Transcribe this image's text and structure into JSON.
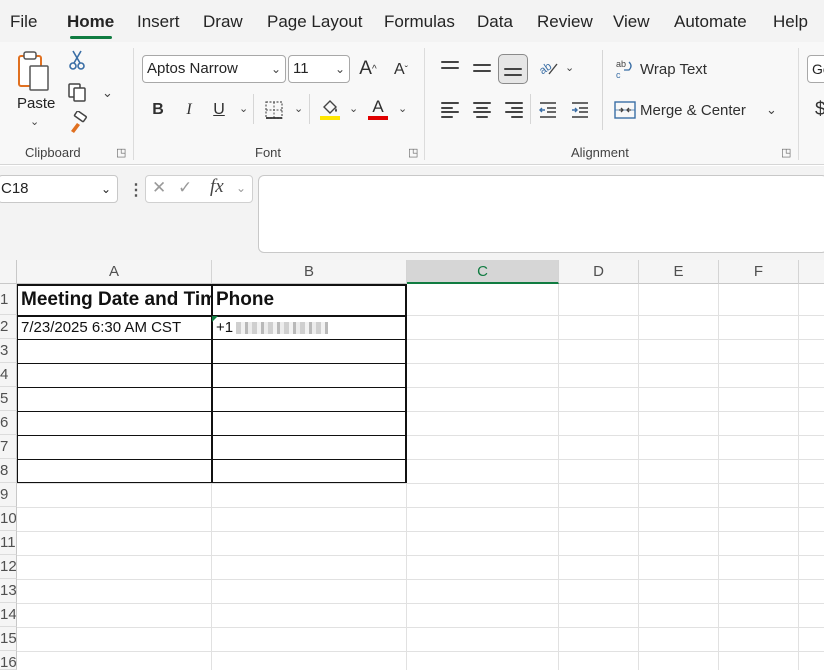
{
  "tabs": [
    "File",
    "Home",
    "Insert",
    "Draw",
    "Page Layout",
    "Formulas",
    "Data",
    "Review",
    "View",
    "Automate",
    "Help"
  ],
  "active_tab": "Home",
  "ribbon": {
    "clipboard": {
      "paste_label": "Paste",
      "group_label": "Clipboard"
    },
    "font": {
      "font_name": "Aptos Narrow",
      "font_size": "11",
      "group_label": "Font",
      "bold": "B",
      "italic": "I",
      "underline": "U",
      "font_color_glyph": "A",
      "grow_glyph": "A",
      "shrink_glyph": "A"
    },
    "alignment": {
      "wrap_text": "Wrap Text",
      "merge_center": "Merge & Center",
      "group_label": "Alignment"
    },
    "number": {
      "format_partial": "Ge",
      "currency_partial": "$"
    }
  },
  "formula_bar": {
    "name_box": "C18",
    "fx_label": "fx",
    "formula_value": ""
  },
  "grid": {
    "columns": [
      "A",
      "B",
      "C",
      "D",
      "E",
      "F"
    ],
    "selected_column": "C",
    "rows": [
      "1",
      "2",
      "3",
      "4",
      "5",
      "6",
      "7",
      "8",
      "9",
      "10",
      "11",
      "12",
      "13",
      "14",
      "15",
      "16"
    ],
    "cells": {
      "A1": "Meeting Date and Time",
      "B1": "Phone",
      "A2": "7/23/2025 6:30 AM CST",
      "B2": "+1"
    }
  },
  "colors": {
    "accent": "#107c41",
    "highlight_yellow": "#ffe600",
    "font_red": "#e00000"
  }
}
